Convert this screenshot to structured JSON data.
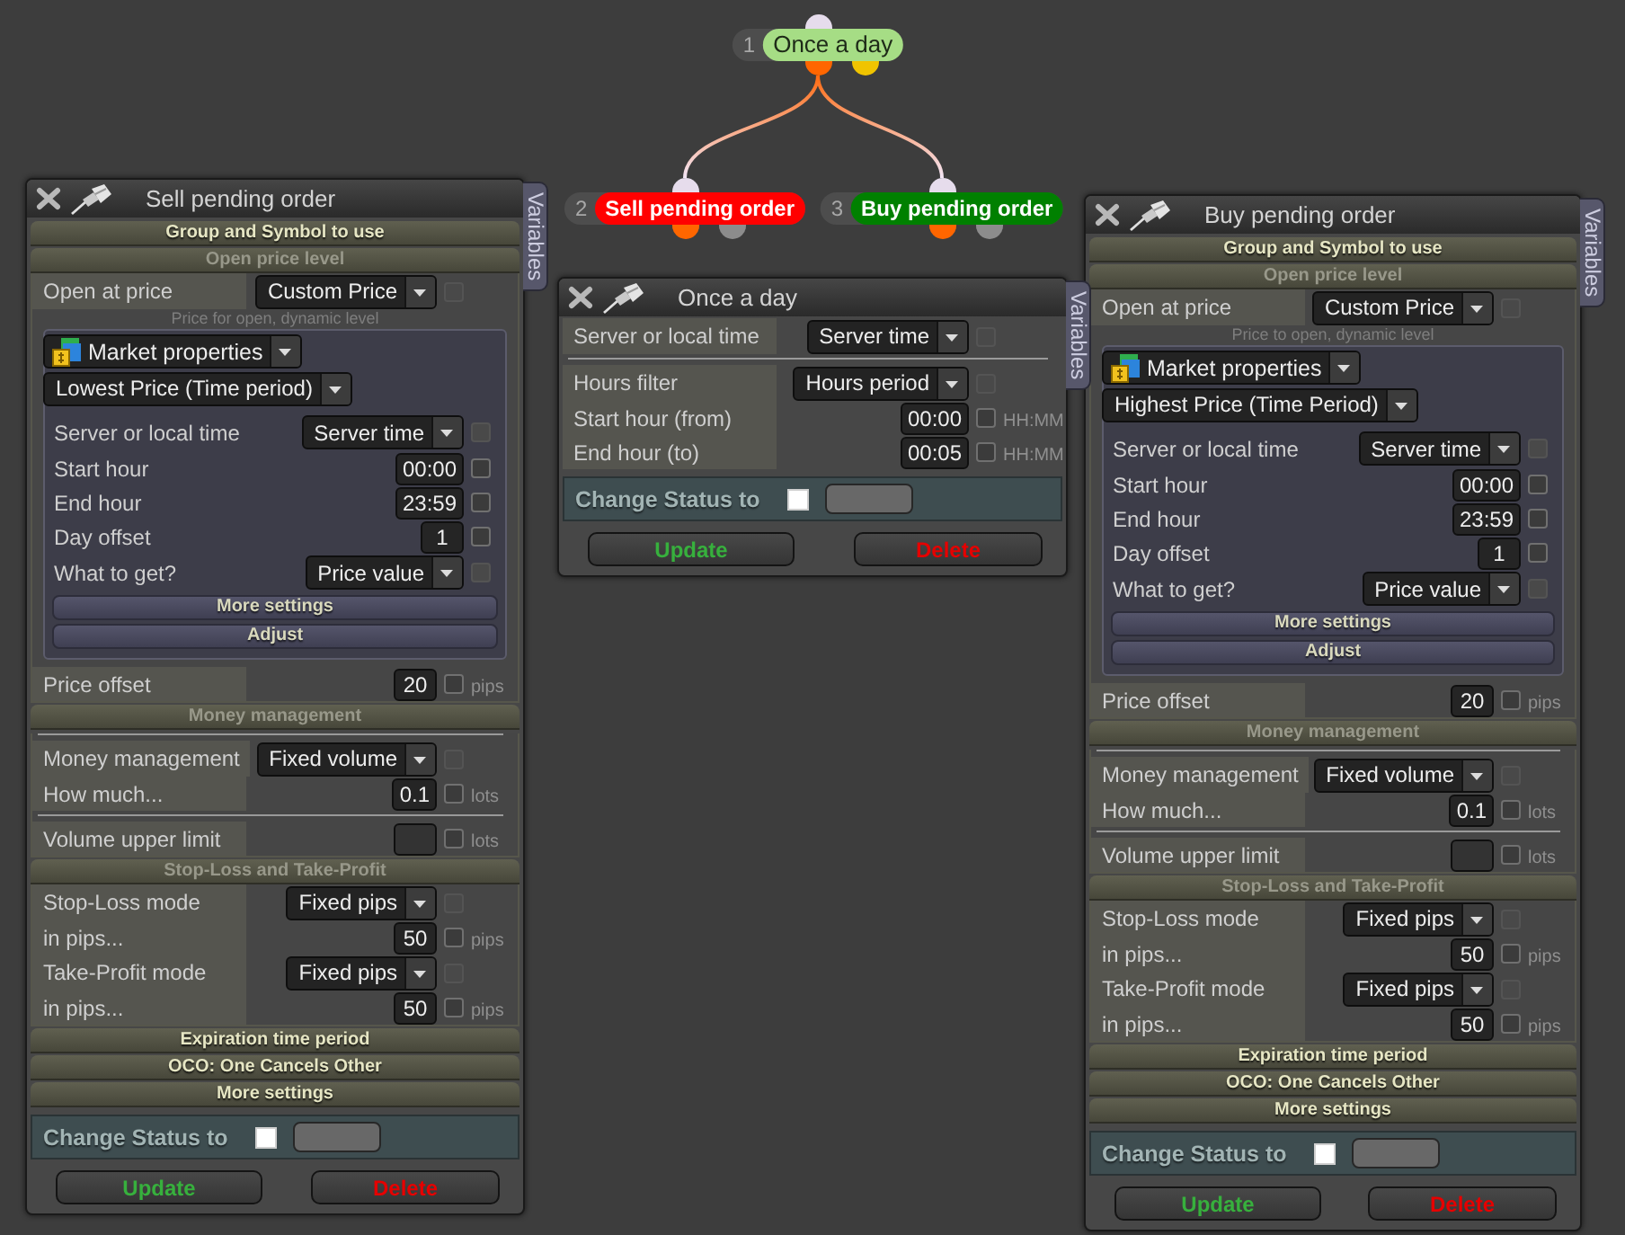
{
  "flow": {
    "number": "1",
    "label": "Once a day",
    "color": "#a6dd85",
    "outputs": [
      {
        "color": "#ff6600"
      },
      {
        "color": "#f0c400"
      }
    ],
    "children": [
      {
        "number": "2",
        "label": "Sell pending order",
        "color": "#ff0000",
        "outputs": [
          {
            "color": "#ff6600"
          },
          {
            "color": "#8c8c8c"
          }
        ]
      },
      {
        "number": "3",
        "label": "Buy pending order",
        "color": "#008000",
        "outputs": [
          {
            "color": "#ff6600"
          },
          {
            "color": "#8c8c8c"
          }
        ]
      }
    ]
  },
  "panels": [
    {
      "title": "Sell pending order",
      "side_tab": "Variables",
      "rows": [
        {
          "kind": "section",
          "title": "Group and Symbol to use",
          "expanded": false
        },
        {
          "kind": "section",
          "title": "Open price level",
          "expanded": true,
          "rows": [
            {
              "kind": "select",
              "label": "Open at price",
              "value": "Custom Price",
              "checkbox": {
                "checked": false,
                "disabled": true
              }
            },
            {
              "kind": "note",
              "text": "Price for open, dynamic level"
            },
            {
              "kind": "group",
              "rows": [
                {
                  "kind": "source",
                  "value": "Market properties"
                },
                {
                  "kind": "select",
                  "value": "Lowest Price (Time period)"
                },
                {
                  "kind": "select",
                  "label": "Server or local time",
                  "value": "Server time",
                  "checkbox": {
                    "checked": false,
                    "disabled": true
                  }
                },
                {
                  "kind": "field",
                  "label": "Start hour",
                  "value": "00:00",
                  "checkbox": {
                    "checked": false,
                    "disabled": false
                  }
                },
                {
                  "kind": "field",
                  "label": "End hour",
                  "value": "23:59",
                  "checkbox": {
                    "checked": false,
                    "disabled": false
                  }
                },
                {
                  "kind": "field",
                  "label": "Day offset",
                  "value": "1",
                  "checkbox": {
                    "checked": false,
                    "disabled": false
                  }
                },
                {
                  "kind": "select",
                  "label": "What to get?",
                  "value": "Price value",
                  "checkbox": {
                    "checked": false,
                    "disabled": true
                  }
                },
                {
                  "kind": "button",
                  "label": "More settings"
                },
                {
                  "kind": "button",
                  "label": "Adjust"
                }
              ]
            },
            {
              "kind": "field",
              "label": "Price offset",
              "value": "20",
              "checkbox": {
                "checked": false,
                "disabled": false
              },
              "unit": "pips"
            }
          ]
        },
        {
          "kind": "section",
          "title": "Money management",
          "expanded": true,
          "rows": [
            {
              "kind": "divider"
            },
            {
              "kind": "select",
              "label": "Money management",
              "value": "Fixed volume",
              "checkbox": {
                "checked": false,
                "disabled": true
              }
            },
            {
              "kind": "field",
              "label": "How much...",
              "value": "0.1",
              "checkbox": {
                "checked": false,
                "disabled": false
              },
              "unit": "lots"
            },
            {
              "kind": "divider"
            },
            {
              "kind": "field",
              "label": "Volume upper limit",
              "checkbox": {
                "checked": false,
                "disabled": false
              },
              "unit": "lots"
            }
          ]
        },
        {
          "kind": "section",
          "title": "Stop-Loss and Take-Profit",
          "expanded": true,
          "rows": [
            {
              "kind": "select",
              "label": "Stop-Loss mode",
              "value": "Fixed pips",
              "checkbox": {
                "checked": false,
                "disabled": true
              }
            },
            {
              "kind": "field",
              "label": "in pips...",
              "value": "50",
              "checkbox": {
                "checked": false,
                "disabled": false
              },
              "unit": "pips"
            },
            {
              "kind": "select",
              "label": "Take-Profit mode",
              "value": "Fixed pips",
              "checkbox": {
                "checked": false,
                "disabled": true
              }
            },
            {
              "kind": "field",
              "label": "in pips...",
              "value": "50",
              "checkbox": {
                "checked": false,
                "disabled": false
              },
              "unit": "pips"
            }
          ]
        },
        {
          "kind": "section",
          "title": "Expiration time period",
          "expanded": false
        },
        {
          "kind": "section",
          "title": "OCO: One Cancels Other",
          "expanded": false
        },
        {
          "kind": "section",
          "title": "More settings",
          "expanded": false
        }
      ],
      "status": {
        "label": "Change Status to",
        "checked": false
      },
      "buttons": [
        {
          "label": "Update",
          "kind": "update"
        },
        {
          "label": "Delete",
          "kind": "delete"
        }
      ]
    },
    {
      "title": "Once a day",
      "side_tab": "Variables",
      "rows": [
        {
          "kind": "select",
          "label": "Server or local time",
          "value": "Server time",
          "checkbox": {
            "checked": false,
            "disabled": true
          }
        },
        {
          "kind": "divider"
        },
        {
          "kind": "select",
          "label": "Hours filter",
          "value": "Hours period",
          "checkbox": {
            "checked": false,
            "disabled": true
          }
        },
        {
          "kind": "field",
          "label": "Start hour (from)",
          "value": "00:00",
          "checkbox": {
            "checked": false,
            "disabled": false
          },
          "unit": "HH:MM"
        },
        {
          "kind": "field",
          "label": "End hour (to)",
          "value": "00:05",
          "checkbox": {
            "checked": false,
            "disabled": false
          },
          "unit": "HH:MM"
        }
      ],
      "status": {
        "label": "Change Status to",
        "checked": false
      },
      "buttons": [
        {
          "label": "Update",
          "kind": "update"
        },
        {
          "label": "Delete",
          "kind": "delete"
        }
      ]
    },
    {
      "title": "Buy pending order",
      "side_tab": "Variables",
      "rows": [
        {
          "kind": "section",
          "title": "Group and Symbol to use",
          "expanded": false
        },
        {
          "kind": "section",
          "title": "Open price level",
          "expanded": true,
          "rows": [
            {
              "kind": "select",
              "label": "Open at price",
              "value": "Custom Price",
              "checkbox": {
                "checked": false,
                "disabled": true
              }
            },
            {
              "kind": "note",
              "text": "Price to open, dynamic level"
            },
            {
              "kind": "group",
              "rows": [
                {
                  "kind": "source",
                  "value": "Market properties"
                },
                {
                  "kind": "select",
                  "value": "Highest Price (Time Period)"
                },
                {
                  "kind": "select",
                  "label": "Server or local time",
                  "value": "Server time",
                  "checkbox": {
                    "checked": false,
                    "disabled": true
                  }
                },
                {
                  "kind": "field",
                  "label": "Start hour",
                  "value": "00:00",
                  "checkbox": {
                    "checked": false,
                    "disabled": false
                  }
                },
                {
                  "kind": "field",
                  "label": "End hour",
                  "value": "23:59",
                  "checkbox": {
                    "checked": false,
                    "disabled": false
                  }
                },
                {
                  "kind": "field",
                  "label": "Day offset",
                  "value": "1",
                  "checkbox": {
                    "checked": false,
                    "disabled": false
                  }
                },
                {
                  "kind": "select",
                  "label": "What to get?",
                  "value": "Price value",
                  "checkbox": {
                    "checked": false,
                    "disabled": true
                  }
                },
                {
                  "kind": "button",
                  "label": "More settings"
                },
                {
                  "kind": "button",
                  "label": "Adjust"
                }
              ]
            },
            {
              "kind": "field",
              "label": "Price offset",
              "value": "20",
              "checkbox": {
                "checked": false,
                "disabled": false
              },
              "unit": "pips"
            }
          ]
        },
        {
          "kind": "section",
          "title": "Money management",
          "expanded": true,
          "rows": [
            {
              "kind": "divider"
            },
            {
              "kind": "select",
              "label": "Money management",
              "value": "Fixed volume",
              "checkbox": {
                "checked": false,
                "disabled": true
              }
            },
            {
              "kind": "field",
              "label": "How much...",
              "value": "0.1",
              "checkbox": {
                "checked": false,
                "disabled": false
              },
              "unit": "lots"
            },
            {
              "kind": "divider"
            },
            {
              "kind": "field",
              "label": "Volume upper limit",
              "checkbox": {
                "checked": false,
                "disabled": false
              },
              "unit": "lots"
            }
          ]
        },
        {
          "kind": "section",
          "title": "Stop-Loss and Take-Profit",
          "expanded": true,
          "rows": [
            {
              "kind": "select",
              "label": "Stop-Loss mode",
              "value": "Fixed pips",
              "checkbox": {
                "checked": false,
                "disabled": true
              }
            },
            {
              "kind": "field",
              "label": "in pips...",
              "value": "50",
              "checkbox": {
                "checked": false,
                "disabled": false
              },
              "unit": "pips"
            },
            {
              "kind": "select",
              "label": "Take-Profit mode",
              "value": "Fixed pips",
              "checkbox": {
                "checked": false,
                "disabled": true
              }
            },
            {
              "kind": "field",
              "label": "in pips...",
              "value": "50",
              "checkbox": {
                "checked": false,
                "disabled": false
              },
              "unit": "pips"
            }
          ]
        },
        {
          "kind": "section",
          "title": "Expiration time period",
          "expanded": false
        },
        {
          "kind": "section",
          "title": "OCO: One Cancels Other",
          "expanded": false
        },
        {
          "kind": "section",
          "title": "More settings",
          "expanded": false
        }
      ],
      "status": {
        "label": "Change Status to",
        "checked": false
      },
      "buttons": [
        {
          "label": "Update",
          "kind": "update"
        },
        {
          "label": "Delete",
          "kind": "delete"
        }
      ]
    }
  ]
}
